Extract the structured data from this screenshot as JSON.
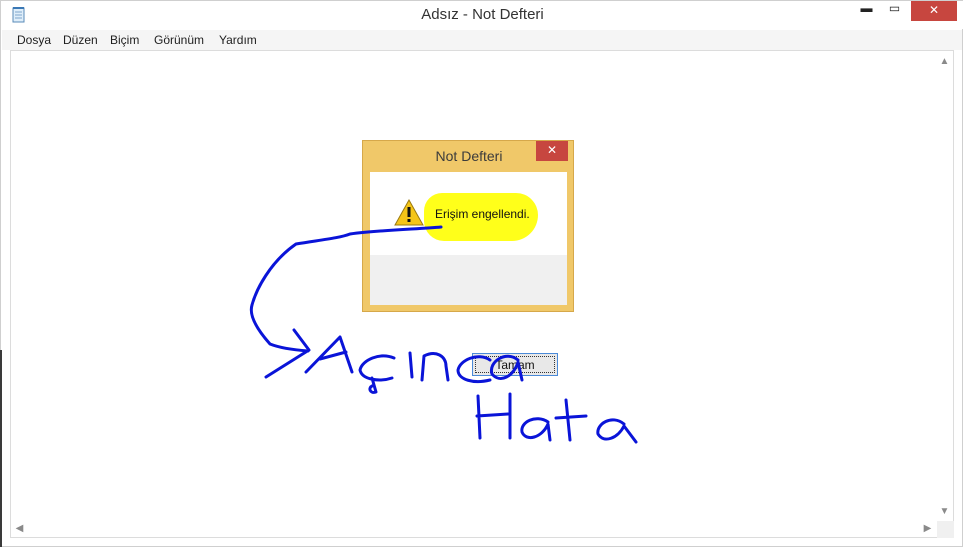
{
  "window": {
    "title": "Adsız - Not Defteri",
    "close_glyph": "✕",
    "min_glyph": "▬",
    "max_glyph": "▭"
  },
  "menu": {
    "items": [
      "Dosya",
      "Düzen",
      "Biçim",
      "Görünüm",
      "Yardım"
    ]
  },
  "dialog": {
    "title": "Not Defteri",
    "close_glyph": "✕",
    "message": "Erişim engellendi.",
    "ok_label": "Tamam"
  },
  "scroll": {
    "up": "▲",
    "down": "▼",
    "left": "◀",
    "right": "▶"
  },
  "colors": {
    "dialog_frame": "#f0c869",
    "highlight": "#ffff1a",
    "ink": "#0a14d8",
    "close_red": "#c7463f"
  },
  "annotation": {
    "line1": "Açınca",
    "line2": "Hata"
  }
}
